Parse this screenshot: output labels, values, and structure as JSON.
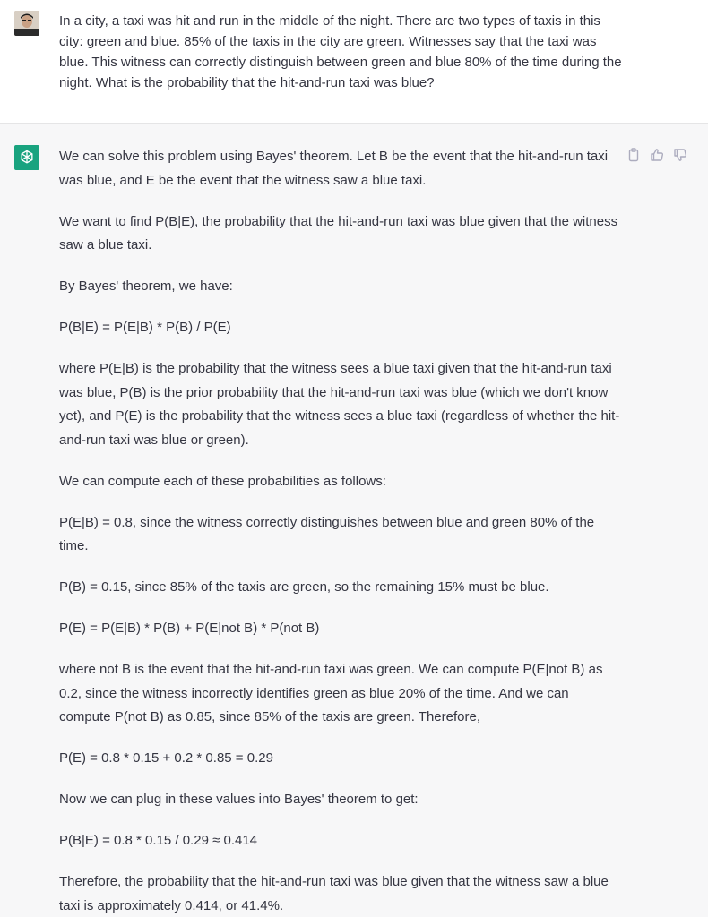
{
  "user_message": {
    "text": "In a city, a taxi was hit and run in the middle of the night. There are two types of taxis in this city: green and blue. 85% of the taxis in the city are green. Witnesses say that the taxi was blue. This witness can correctly distinguish between green and blue 80% of the time during the night. What is the probability that the hit-and-run taxi was blue?",
    "avatar_icon": "user-avatar-icon"
  },
  "assistant_message": {
    "avatar_icon": "openai-logo-icon",
    "avatar_color": "#19a37f",
    "paragraphs": [
      "We can solve this problem using Bayes' theorem. Let B be the event that the hit-and-run taxi was blue, and E be the event that the witness saw a blue taxi.",
      "We want to find P(B|E), the probability that the hit-and-run taxi was blue given that the witness saw a blue taxi.",
      "By Bayes' theorem, we have:",
      "P(B|E) = P(E|B) * P(B) / P(E)",
      "where P(E|B) is the probability that the witness sees a blue taxi given that the hit-and-run taxi was blue, P(B) is the prior probability that the hit-and-run taxi was blue (which we don't know yet), and P(E) is the probability that the witness sees a blue taxi (regardless of whether the hit-and-run taxi was blue or green).",
      "We can compute each of these probabilities as follows:",
      "P(E|B) = 0.8, since the witness correctly distinguishes between blue and green 80% of the time.",
      "P(B) = 0.15, since 85% of the taxis are green, so the remaining 15% must be blue.",
      "P(E) = P(E|B) * P(B) + P(E|not B) * P(not B)",
      "where not B is the event that the hit-and-run taxi was green. We can compute P(E|not B) as 0.2, since the witness incorrectly identifies green as blue 20% of the time. And we can compute P(not B) as 0.85, since 85% of the taxis are green. Therefore,",
      "P(E) = 0.8 * 0.15 + 0.2 * 0.85 = 0.29",
      "Now we can plug in these values into Bayes' theorem to get:",
      "P(B|E) = 0.8 * 0.15 / 0.29 ≈ 0.414",
      "Therefore, the probability that the hit-and-run taxi was blue given that the witness saw a blue taxi is approximately 0.414, or 41.4%."
    ],
    "actions": [
      "copy-icon",
      "thumbs-up-icon",
      "thumbs-down-icon"
    ]
  }
}
